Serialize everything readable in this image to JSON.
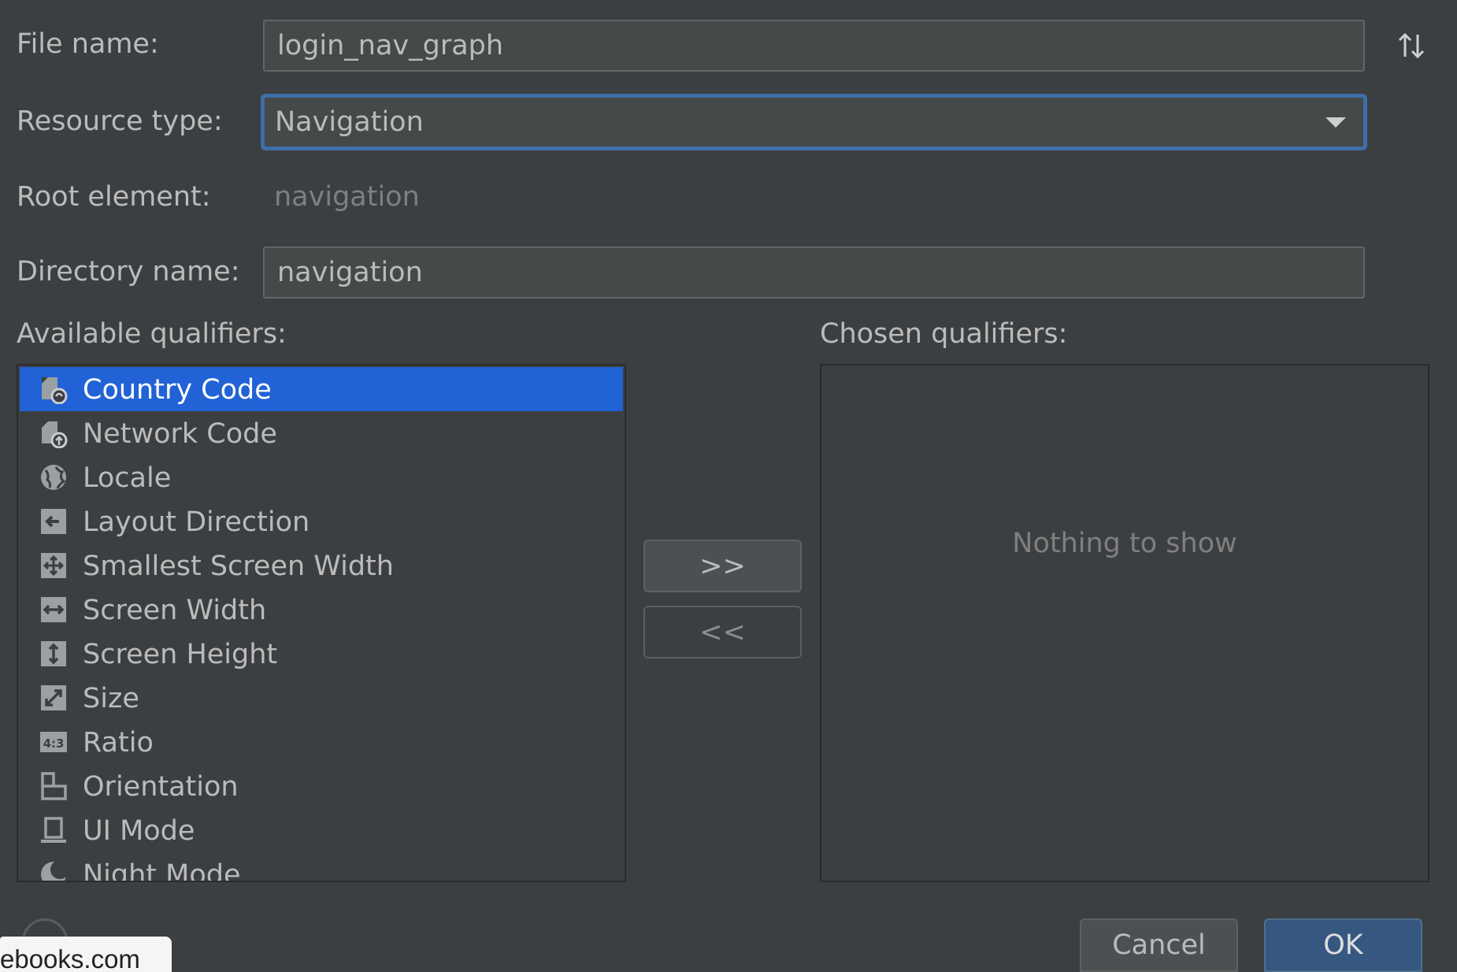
{
  "form": {
    "file_name_label": "File name:",
    "file_name_value": "login_nav_graph",
    "resource_type_label": "Resource type:",
    "resource_type_value": "Navigation",
    "root_element_label": "Root element:",
    "root_element_value": "navigation",
    "directory_name_label": "Directory name:",
    "directory_name_value": "navigation"
  },
  "qualifiers": {
    "available_label": "Available qualifiers:",
    "chosen_label": "Chosen qualifiers:",
    "empty_text": "Nothing to show",
    "items": [
      {
        "label": "Country Code",
        "icon": "country-code-icon",
        "selected": true
      },
      {
        "label": "Network Code",
        "icon": "network-code-icon",
        "selected": false
      },
      {
        "label": "Locale",
        "icon": "globe-icon",
        "selected": false
      },
      {
        "label": "Layout Direction",
        "icon": "layout-direction-icon",
        "selected": false
      },
      {
        "label": "Smallest Screen Width",
        "icon": "smallest-screen-width-icon",
        "selected": false
      },
      {
        "label": "Screen Width",
        "icon": "screen-width-icon",
        "selected": false
      },
      {
        "label": "Screen Height",
        "icon": "screen-height-icon",
        "selected": false
      },
      {
        "label": "Size",
        "icon": "size-icon",
        "selected": false
      },
      {
        "label": "Ratio",
        "icon": "ratio-icon",
        "selected": false
      },
      {
        "label": "Orientation",
        "icon": "orientation-icon",
        "selected": false
      },
      {
        "label": "UI Mode",
        "icon": "ui-mode-icon",
        "selected": false
      },
      {
        "label": "Night Mode",
        "icon": "night-mode-icon",
        "selected": false
      }
    ]
  },
  "buttons": {
    "add": ">>",
    "remove": "<<",
    "cancel": "Cancel",
    "ok": "OK"
  },
  "tooltip": {
    "text": "ebooks.com"
  },
  "colors": {
    "selection": "#2162d6",
    "focus_border": "#3d6fa8",
    "primary_button": "#365880"
  }
}
